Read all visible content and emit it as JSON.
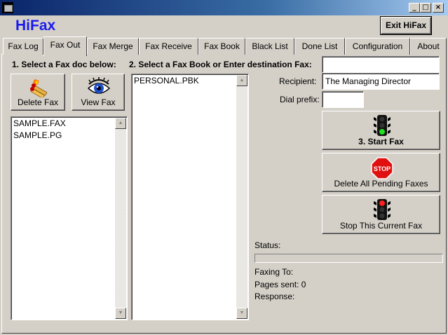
{
  "window": {
    "minimize": "_",
    "maximize": "□",
    "close": "×"
  },
  "app": {
    "brand": "HiFax",
    "exit_label": "Exit HiFax"
  },
  "tabs": [
    {
      "label": "Fax Log"
    },
    {
      "label": "Fax Out",
      "active": true
    },
    {
      "label": "Fax Merge"
    },
    {
      "label": "Fax Receive"
    },
    {
      "label": "Fax Book"
    },
    {
      "label": "Black List"
    },
    {
      "label": "Done List"
    },
    {
      "label": "Configuration"
    },
    {
      "label": "About"
    }
  ],
  "step1": {
    "heading": "1.  Select a Fax doc below:",
    "delete_label": "Delete Fax",
    "view_label": "View Fax",
    "docs": [
      "SAMPLE.FAX",
      "SAMPLE.PG"
    ]
  },
  "step2": {
    "heading": "2.  Select a Fax Book or Enter destination Fax:",
    "books": [
      "PERSONAL.PBK"
    ]
  },
  "form": {
    "fax_value": "",
    "recipient_label": "Recipient:",
    "recipient_value": "The Managing Director",
    "dial_prefix_label": "Dial prefix:",
    "dial_prefix_value": ""
  },
  "actions": {
    "start_label": "3.  Start Fax",
    "delete_pending_label": "Delete All Pending Faxes",
    "stop_label": "Stop This Current Fax",
    "stop_sign_text": "STOP"
  },
  "status": {
    "status_label": "Status:",
    "progress": 0,
    "faxing_to": "Faxing To:",
    "pages_sent": "Pages sent: 0",
    "response": "Response:"
  },
  "colors": {
    "brand": "#1a1af0",
    "title_bar_start": "#0a246a",
    "title_bar_end": "#a6caf0",
    "face": "#d4d0c8"
  },
  "icons": [
    "app-icon",
    "matches-icon",
    "eye-icon",
    "traffic-light-green-icon",
    "stop-sign-icon",
    "traffic-light-red-icon"
  ]
}
